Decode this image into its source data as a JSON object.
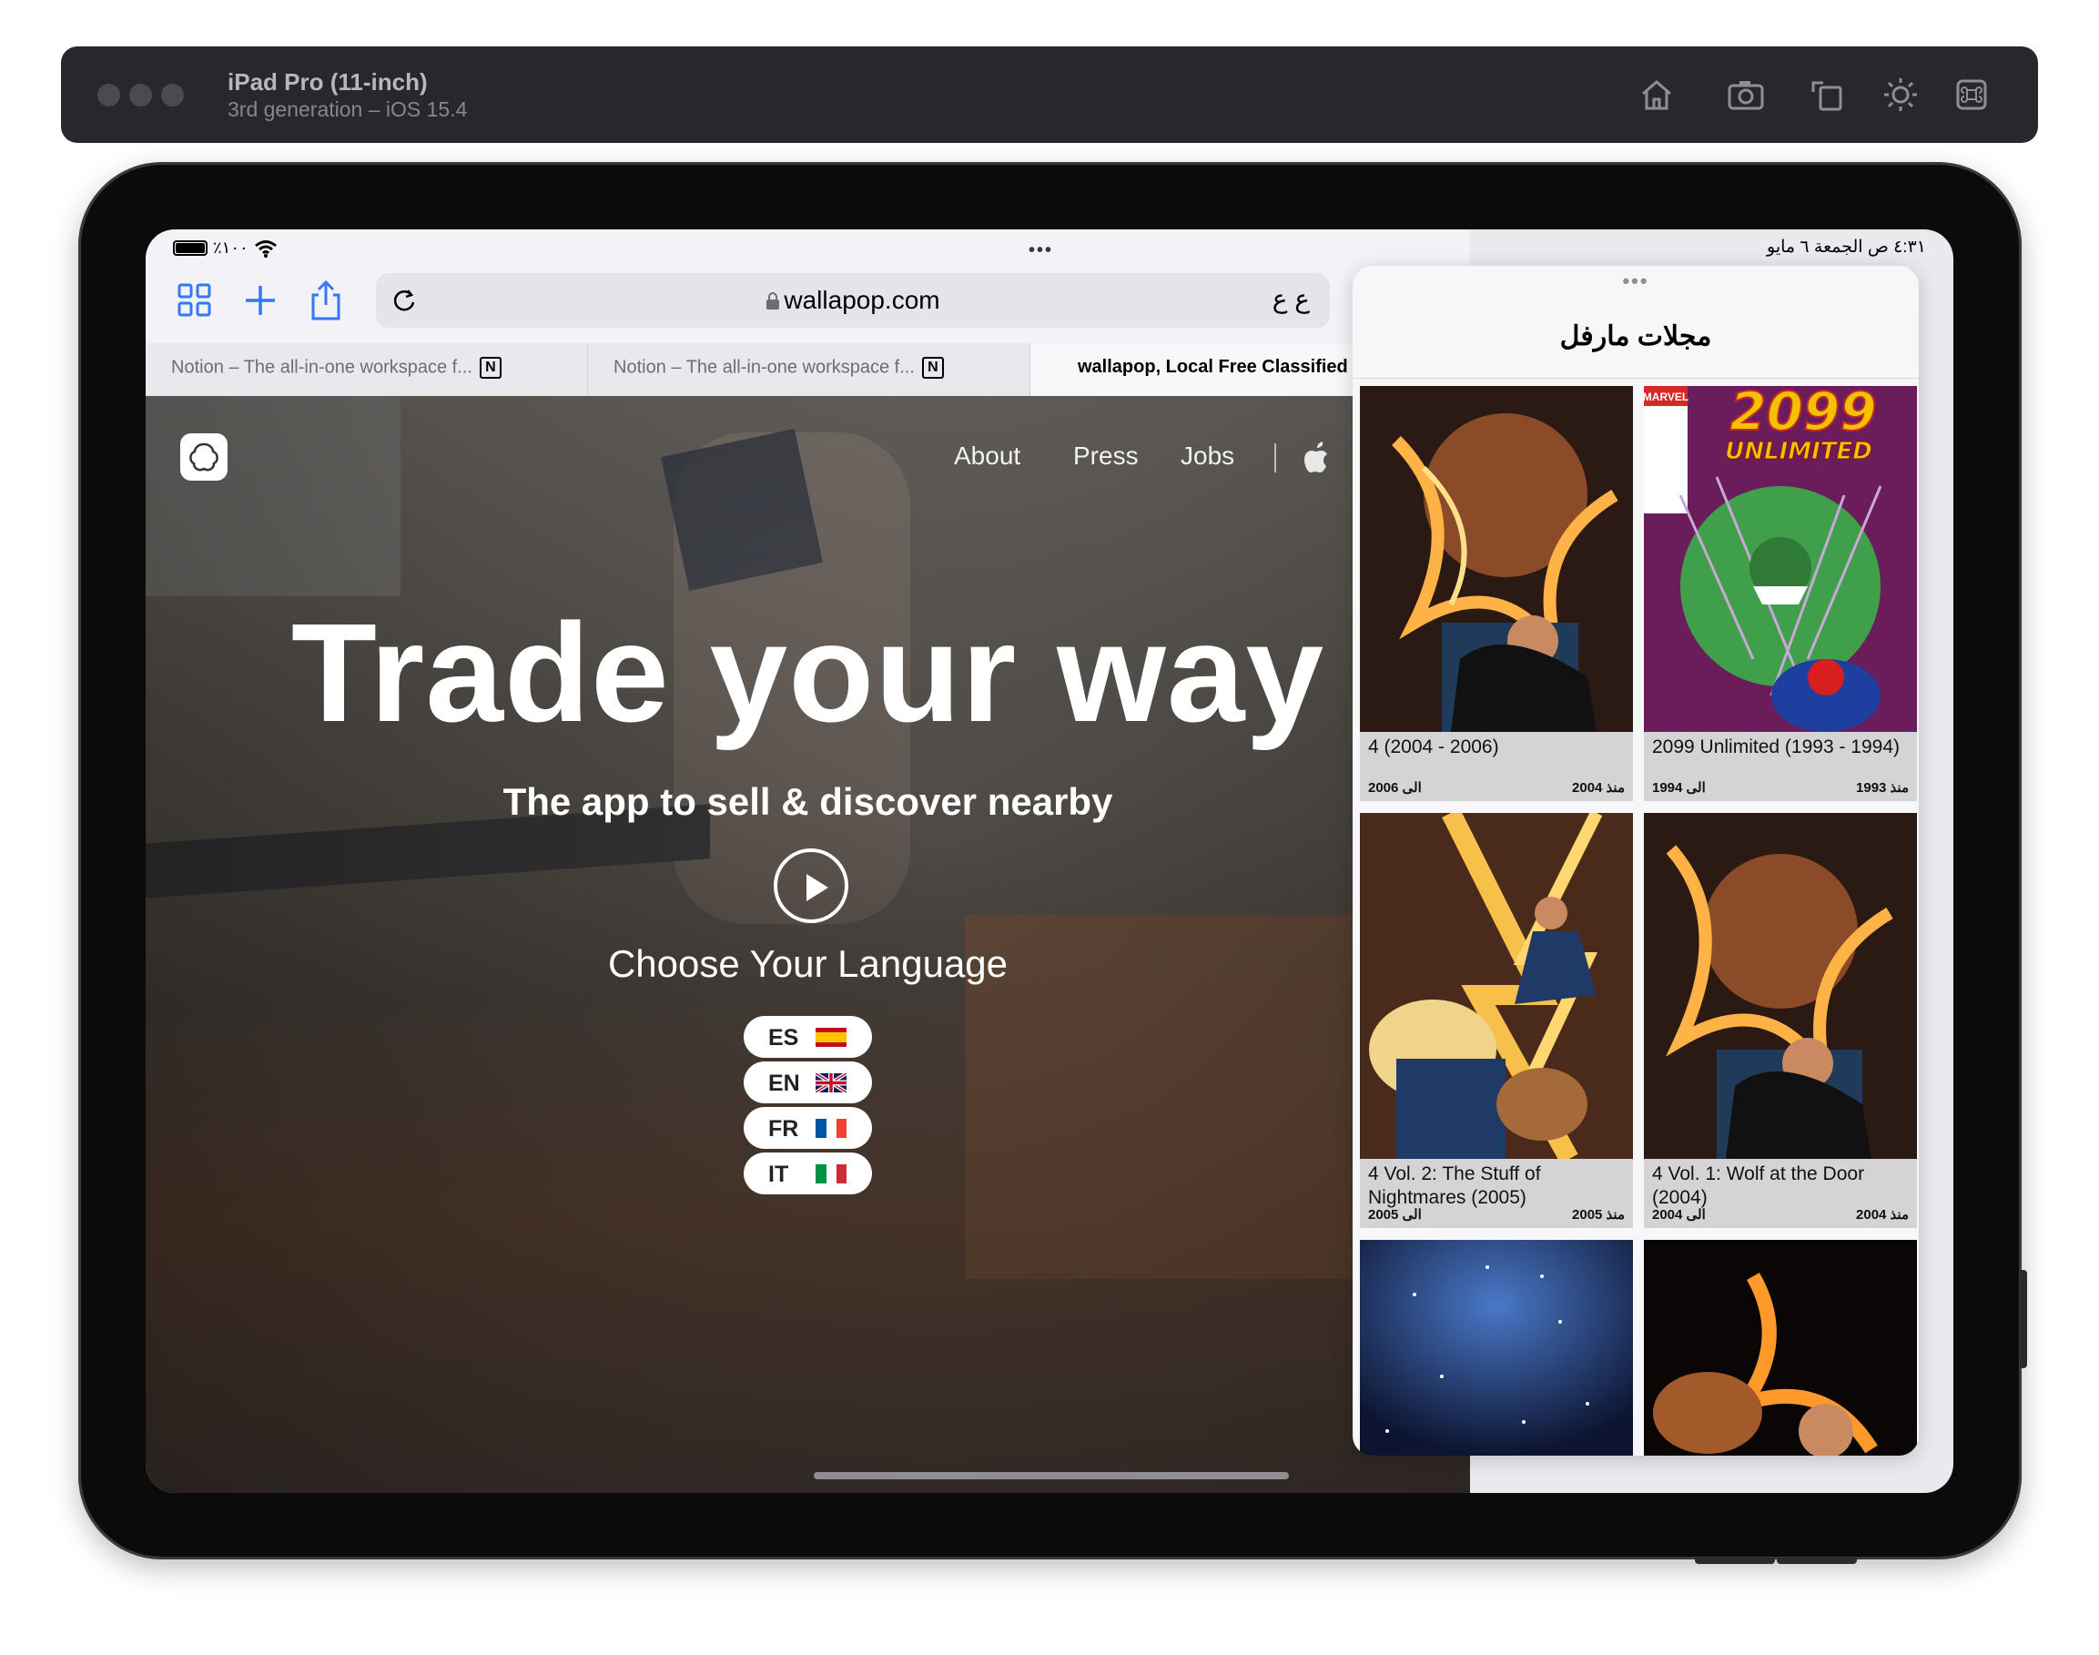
{
  "simulator": {
    "device_name": "iPad Pro (11-inch)",
    "device_sub": "3rd generation – iOS 15.4"
  },
  "status_bar": {
    "battery": "٪١٠٠",
    "clock": "٤:٣١ ص  الجمعة ٦ مايو"
  },
  "safari": {
    "url": "wallapop.com",
    "aa_label": "ع ع",
    "tabs": [
      {
        "label": "Notion – The all-in-one workspace f..."
      },
      {
        "label": "Notion – The all-in-one workspace f..."
      },
      {
        "label": "wallapop, Local Free Classified"
      }
    ],
    "notion_icon_letter": "N"
  },
  "wallapop": {
    "nav": [
      "About",
      "Press",
      "Jobs"
    ],
    "headline": "Trade your way",
    "subheadline": "The app to sell & discover nearby",
    "language_title": "Choose Your Language",
    "languages": [
      {
        "code": "ES"
      },
      {
        "code": "EN"
      },
      {
        "code": "FR"
      },
      {
        "code": "IT"
      }
    ]
  },
  "slide_over": {
    "dots": "•••",
    "title": "مجلات مارفل",
    "cards": [
      {
        "title": "4 (2004 - 2006)",
        "from": "منذ 2004",
        "to": "الى 2006"
      },
      {
        "title": "2099 Unlimited (1993 - 1994)",
        "from": "منذ 1993",
        "to": "الى 1994",
        "cover_brand": "MARVEL",
        "cover_logo": "2099",
        "cover_sub": "UNLIMITED"
      },
      {
        "title": "4 Vol. 2: The Stuff of Nightmares (2005)",
        "from": "منذ 2005",
        "to": "الى 2005"
      },
      {
        "title": "4 Vol. 1: Wolf at the Door (2004)",
        "from": "منذ 2004",
        "to": "الى 2004"
      }
    ]
  },
  "colors": {
    "toolbar": "#27282c",
    "safari_accent": "#3478f6"
  }
}
